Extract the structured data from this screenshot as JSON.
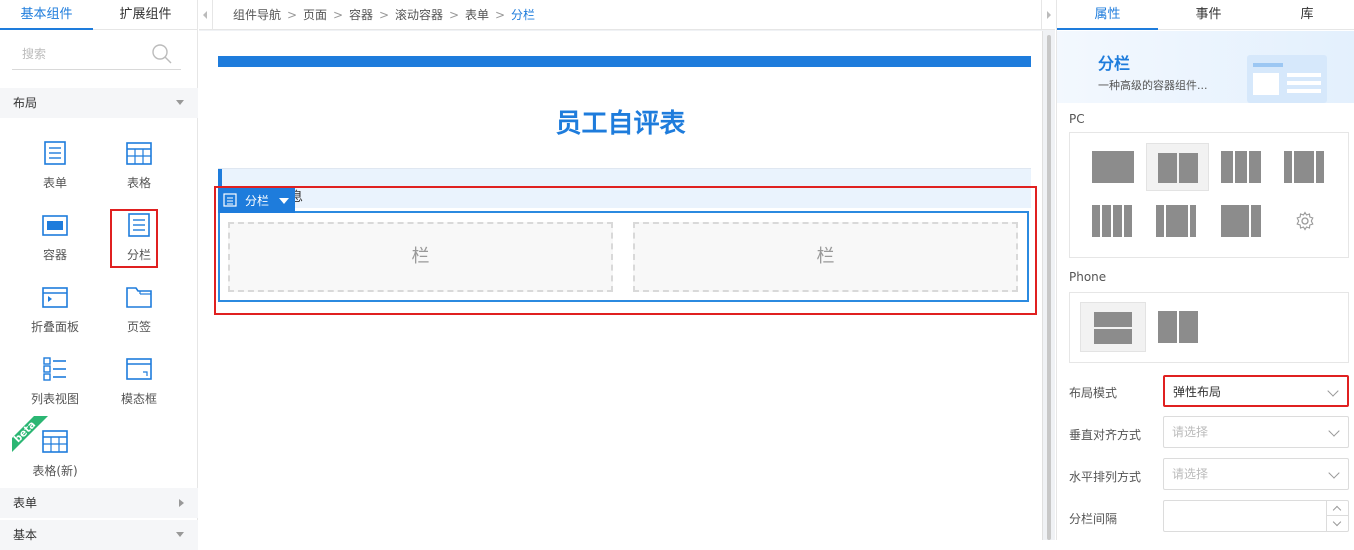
{
  "left_panel": {
    "tabs": [
      {
        "label": "基本组件"
      },
      {
        "label": "扩展组件"
      }
    ],
    "search": {
      "placeholder": "搜索"
    },
    "sections": [
      {
        "label": "布局"
      },
      {
        "label": "表单"
      },
      {
        "label": "基本"
      }
    ],
    "components": [
      {
        "label": "表单",
        "icon": "form-icon"
      },
      {
        "label": "表格",
        "icon": "table-icon"
      },
      {
        "label": "容器",
        "icon": "container-icon"
      },
      {
        "label": "分栏",
        "icon": "columns-icon"
      },
      {
        "label": "折叠面板",
        "icon": "collapse-icon"
      },
      {
        "label": "页签",
        "icon": "tabs-icon"
      },
      {
        "label": "列表视图",
        "icon": "list-view-icon"
      },
      {
        "label": "模态框",
        "icon": "modal-icon"
      },
      {
        "label": "表格(新)",
        "icon": "table-new-icon",
        "badge": "beta"
      }
    ]
  },
  "breadcrumb": {
    "items": [
      "组件导航",
      "页面",
      "容器",
      "滚动容器",
      "表单",
      "分栏"
    ],
    "separator": ">"
  },
  "canvas": {
    "form_title": "员工自评表",
    "section_title_partial": "息",
    "selected_label": "分栏",
    "column_placeholders": [
      "栏",
      "栏"
    ]
  },
  "right_panel": {
    "tabs": [
      {
        "label": "属性"
      },
      {
        "label": "事件"
      },
      {
        "label": "库"
      }
    ],
    "header": {
      "title": "分栏",
      "subtitle": "一种高级的容器组件..."
    },
    "pc_label": "PC",
    "phone_label": "Phone",
    "properties": [
      {
        "label": "布局模式",
        "value": "弹性布局"
      },
      {
        "label": "垂直对齐方式",
        "placeholder": "请选择"
      },
      {
        "label": "水平排列方式",
        "placeholder": "请选择"
      },
      {
        "label": "分栏间隔",
        "value": ""
      }
    ]
  },
  "colors": {
    "accent": "#1e7cdc",
    "highlight": "#e02020",
    "beta": "#2bb673"
  }
}
